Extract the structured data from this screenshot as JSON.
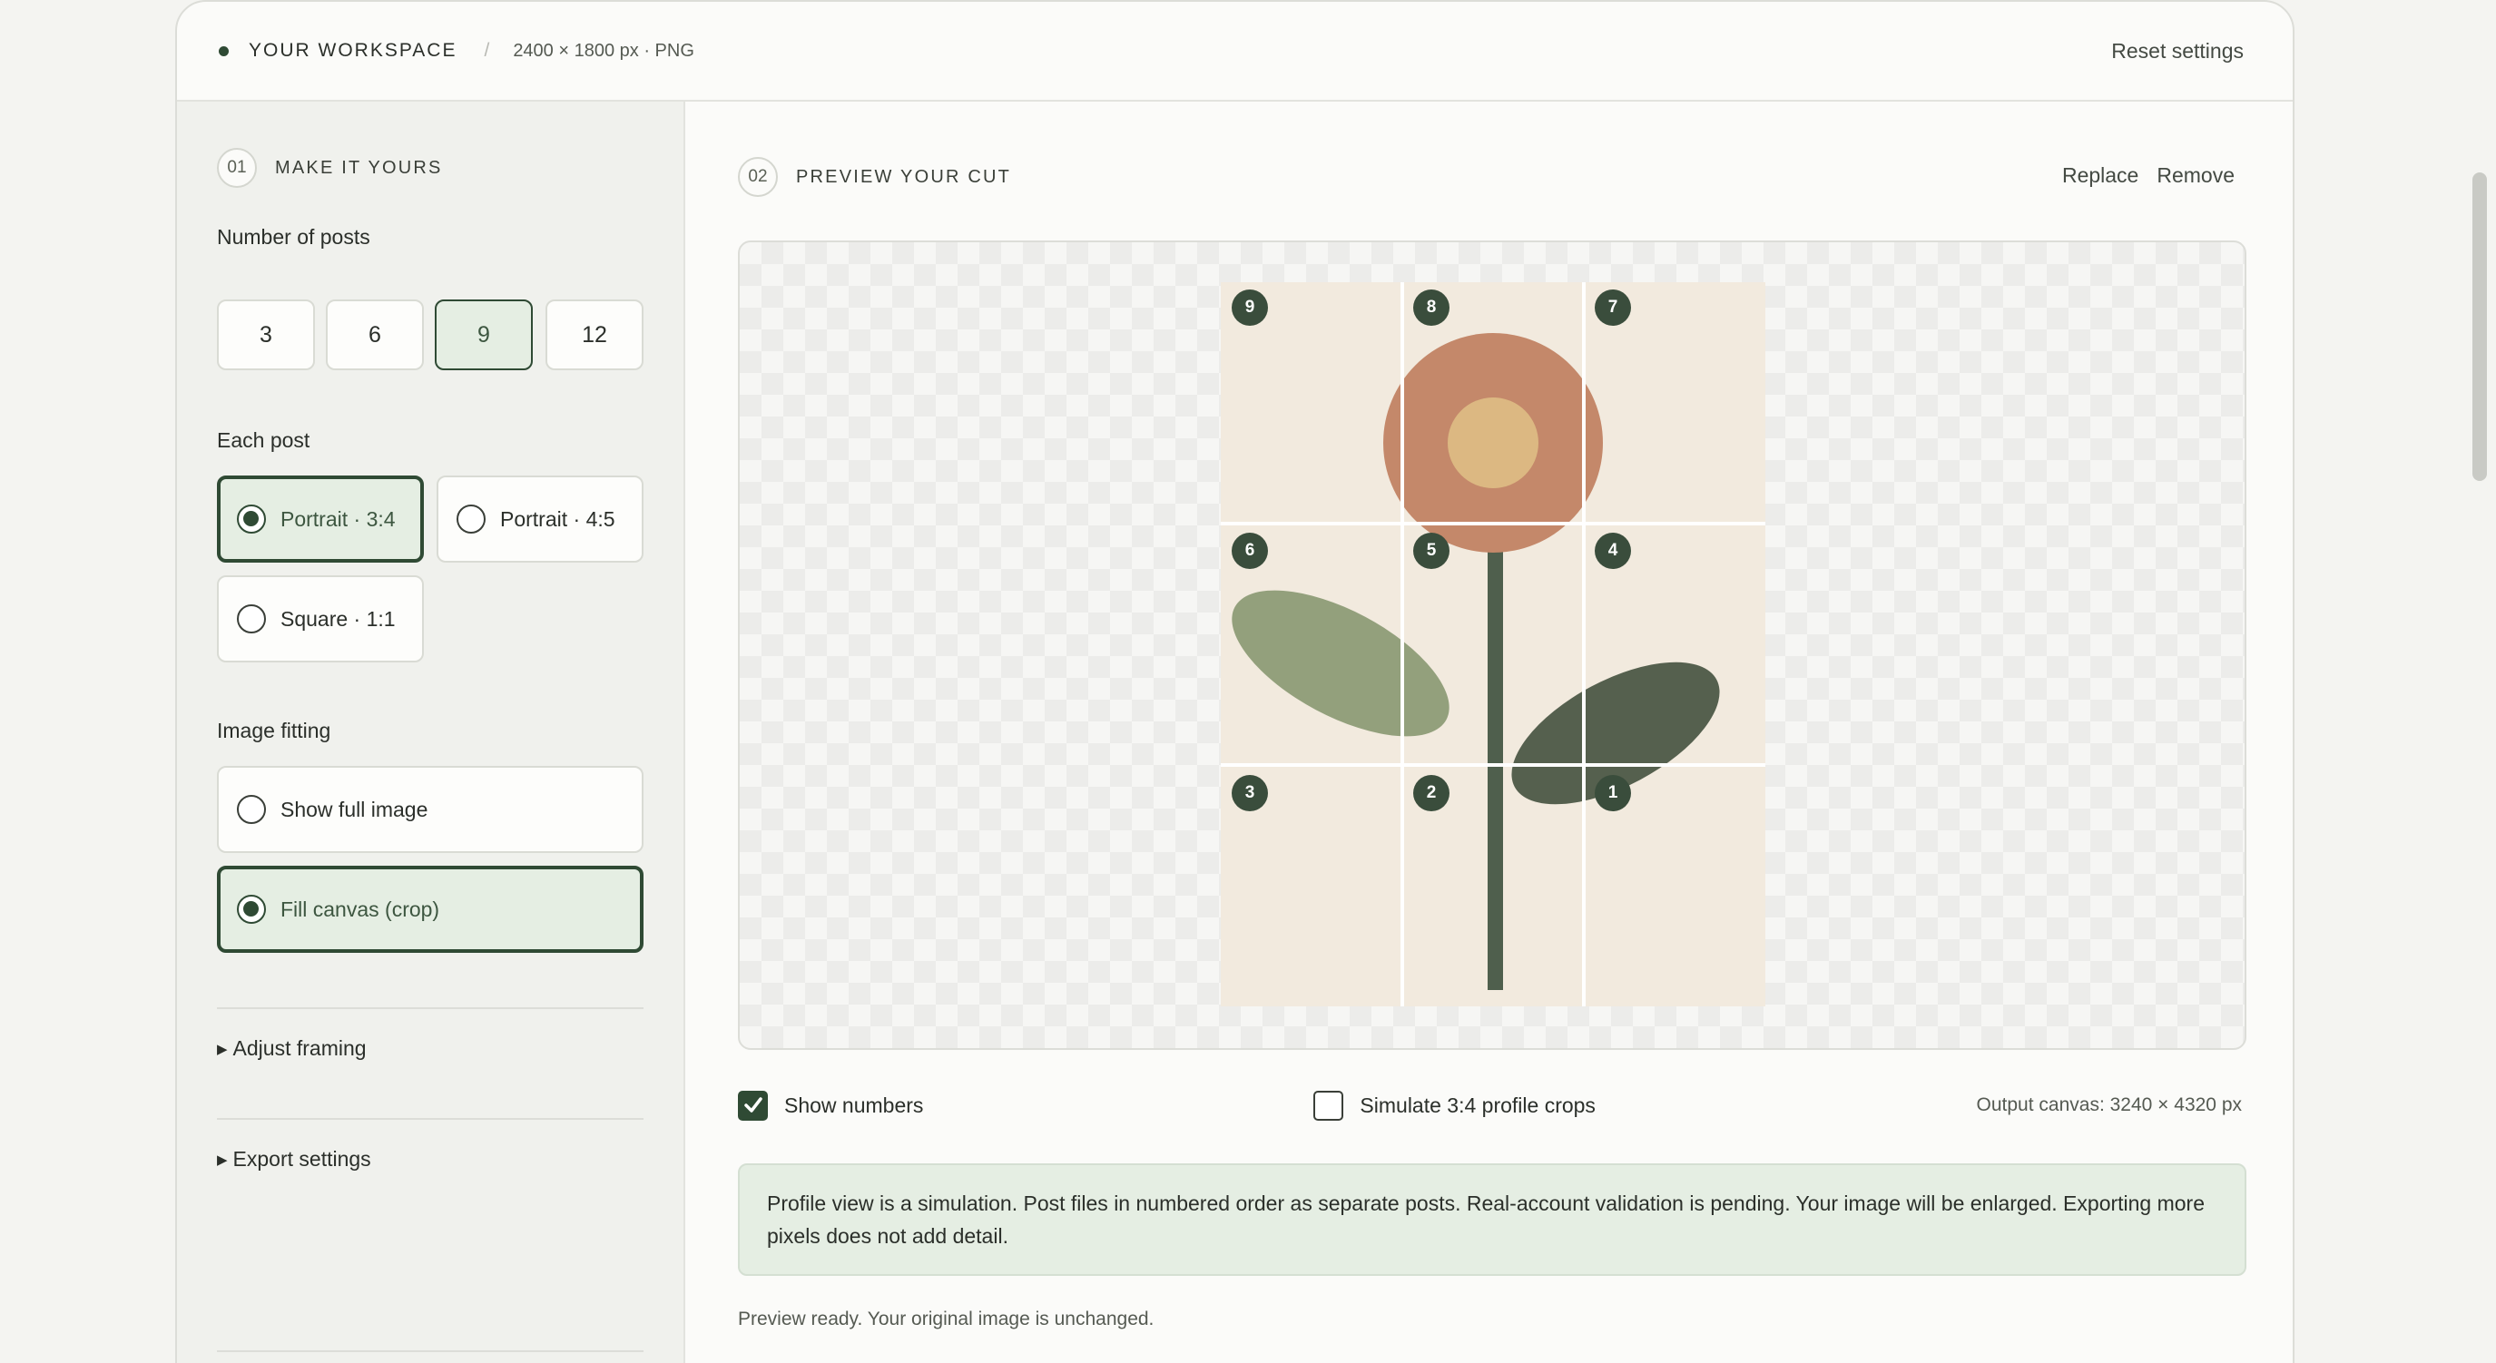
{
  "topbar": {
    "workspace_title": "YOUR WORKSPACE",
    "separator": "/",
    "image_meta": "2400 × 1800 px · PNG",
    "reset_label": "Reset settings"
  },
  "left": {
    "section_num": "01",
    "section_title": "MAKE IT YOURS",
    "posts_label": "Number of posts",
    "post_counts": [
      "3",
      "6",
      "9",
      "12"
    ],
    "selected_count": "9",
    "each_post_label": "Each post",
    "formats": [
      "Portrait · 3:4",
      "Portrait · 4:5",
      "Square · 1:1"
    ],
    "selected_format": "Portrait · 3:4",
    "fitting_label": "Image fitting",
    "fitting": [
      "Show full image",
      "Fill canvas (crop)"
    ],
    "selected_fitting": "Fill canvas (crop)",
    "adjust_framing": "Adjust framing",
    "export_settings": "Export settings"
  },
  "right": {
    "section_num": "02",
    "section_title": "PREVIEW YOUR CUT",
    "replace_label": "Replace",
    "remove_label": "Remove",
    "tile_numbers": [
      "9",
      "8",
      "7",
      "6",
      "5",
      "4",
      "3",
      "2",
      "1"
    ],
    "show_numbers_label": "Show numbers",
    "show_numbers_checked": true,
    "simulate_label": "Simulate 3:4 profile crops",
    "simulate_checked": false,
    "output_canvas": "Output canvas: 3240 × 4320 px",
    "notice": "Profile view is a simulation. Post files in numbered order as separate posts. Real-account validation is pending. Your image will be enlarged. Exporting more pixels does not add detail.",
    "status": "Preview ready. Your original image is unchanged."
  },
  "colors": {
    "accent": "#2f4a34",
    "accent_soft": "#e5eee3",
    "flower_petal": "#c4886a",
    "flower_center": "#dcb882",
    "leaf_light": "#93a07c",
    "leaf_dark": "#55604e",
    "stem": "#4f5f4d",
    "art_bg": "#f2eade"
  }
}
